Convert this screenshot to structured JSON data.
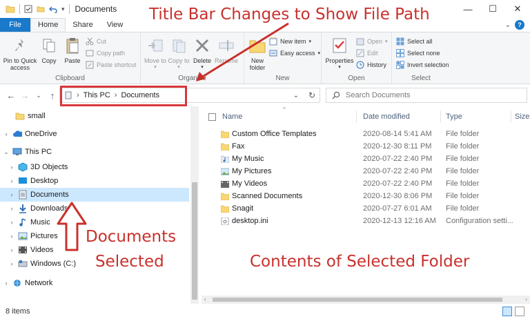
{
  "window": {
    "title": "Documents",
    "controls": {
      "minimize": "—",
      "maximize": "☐",
      "close": "✕"
    }
  },
  "tabs": [
    {
      "label": "File"
    },
    {
      "label": "Home"
    },
    {
      "label": "Share"
    },
    {
      "label": "View"
    }
  ],
  "ribbon": {
    "clipboard": {
      "label": "Clipboard",
      "pin": "Pin to Quick access",
      "copy": "Copy",
      "paste": "Paste",
      "cut": "Cut",
      "copy_path": "Copy path",
      "paste_shortcut": "Paste shortcut"
    },
    "organize": {
      "label": "Organize",
      "move_to": "Move to",
      "copy_to": "Copy to",
      "delete": "Delete",
      "rename": "Rename"
    },
    "new": {
      "label": "New",
      "new_folder": "New folder",
      "new_item": "New item",
      "easy_access": "Easy access"
    },
    "open": {
      "label": "Open",
      "properties": "Properties",
      "open": "Open",
      "edit": "Edit",
      "history": "History"
    },
    "select": {
      "label": "Select",
      "select_all": "Select all",
      "select_none": "Select none",
      "invert_selection": "Invert selection"
    }
  },
  "address": {
    "crumbs": [
      "This PC",
      "Documents"
    ],
    "search_placeholder": "Search Documents"
  },
  "nav": {
    "items": [
      {
        "label": "small",
        "icon": "folder-icon"
      },
      {
        "label": "OneDrive",
        "icon": "cloud-icon"
      },
      {
        "label": "This PC",
        "icon": "computer-icon"
      },
      {
        "label": "3D Objects",
        "icon": "cube-icon"
      },
      {
        "label": "Desktop",
        "icon": "desktop-icon"
      },
      {
        "label": "Documents",
        "icon": "document-icon",
        "selected": true
      },
      {
        "label": "Downloads",
        "icon": "download-icon"
      },
      {
        "label": "Music",
        "icon": "music-icon"
      },
      {
        "label": "Pictures",
        "icon": "picture-icon"
      },
      {
        "label": "Videos",
        "icon": "video-icon"
      },
      {
        "label": "Windows (C:)",
        "icon": "drive-icon"
      },
      {
        "label": "Network",
        "icon": "network-icon"
      }
    ]
  },
  "columns": {
    "name": "Name",
    "date": "Date modified",
    "type": "Type",
    "size": "Size"
  },
  "files": [
    {
      "name": "Custom Office Templates",
      "date": "2020-08-14 5:41 AM",
      "type": "File folder"
    },
    {
      "name": "Fax",
      "date": "2020-12-30 8:11 PM",
      "type": "File folder"
    },
    {
      "name": "My Music",
      "date": "2020-07-22 2:40 PM",
      "type": "File folder"
    },
    {
      "name": "My Pictures",
      "date": "2020-07-22 2:40 PM",
      "type": "File folder"
    },
    {
      "name": "My Videos",
      "date": "2020-07-22 2:40 PM",
      "type": "File folder"
    },
    {
      "name": "Scanned Documents",
      "date": "2020-12-30 8:06 PM",
      "type": "File folder"
    },
    {
      "name": "Snagit",
      "date": "2020-07-27 6:01 AM",
      "type": "File folder"
    },
    {
      "name": "desktop.ini",
      "date": "2020-12-13 12:16 AM",
      "type": "Configuration setti..."
    }
  ],
  "status": {
    "count": "8 items"
  },
  "annotations": {
    "title_bar": "Title Bar Changes to Show File Path",
    "documents_1": "Documents",
    "documents_2": "Selected",
    "contents": "Contents of Selected Folder"
  },
  "colors": {
    "accent": "#1979ca",
    "annotation": "#c9302c",
    "selection": "#cce8ff",
    "folder": "#f8d775"
  }
}
